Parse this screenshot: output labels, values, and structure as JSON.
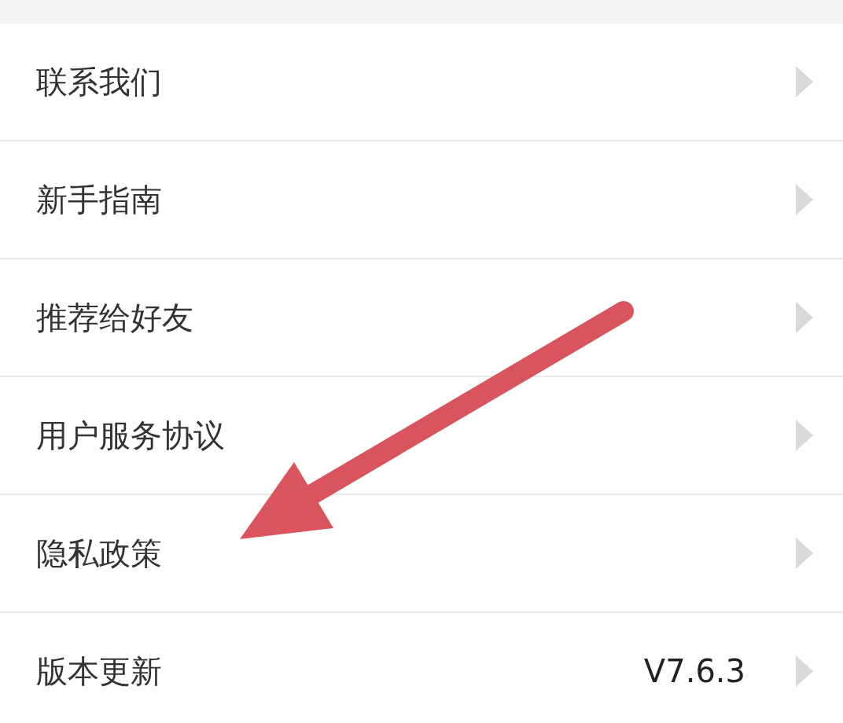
{
  "menu": [
    {
      "label": "联系我们"
    },
    {
      "label": "新手指南"
    },
    {
      "label": "推荐给好友"
    },
    {
      "label": "用户服务协议"
    },
    {
      "label": "隐私政策"
    },
    {
      "label": "版本更新",
      "value": "V7.6.3"
    }
  ],
  "annotations": [
    {
      "kind": "arrow"
    }
  ]
}
